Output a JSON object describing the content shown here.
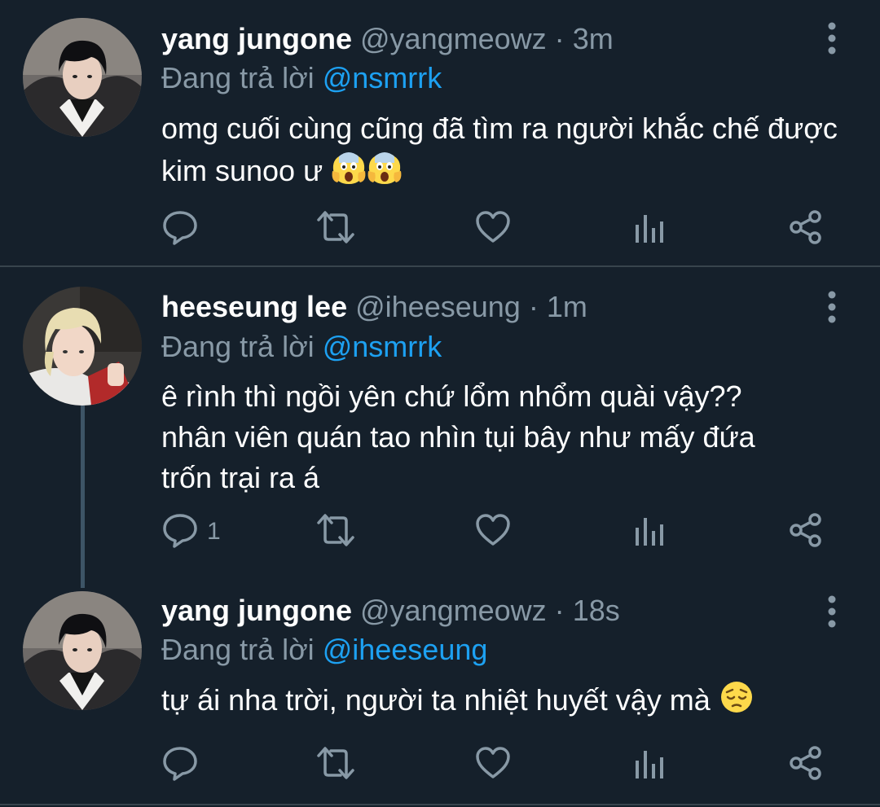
{
  "tweets": [
    {
      "display_name": "yang jungone",
      "handle": "@yangmeowz",
      "separator": "·",
      "time": "3m",
      "reply_prefix": "Đang trả lời",
      "reply_to": "@nsmrrk",
      "text": "omg cuối cùng cũng đã tìm ra người khắc chế được kim sunoo ư",
      "emojis": [
        "screaming-face",
        "screaming-face"
      ],
      "reply_count": "",
      "avatar": "avatar-dark-hair"
    },
    {
      "display_name": "heeseung lee",
      "handle": "@iheeseung",
      "separator": "·",
      "time": "1m",
      "reply_prefix": "Đang trả lời",
      "reply_to": "@nsmrrk",
      "text": "ê rình thì ngồi yên chứ lổm nhổm quài vậy?? nhân viên quán tao nhìn tụi bây như mấy đứa trốn trại ra á",
      "emojis": [],
      "reply_count": "1",
      "avatar": "avatar-blonde-hair"
    },
    {
      "display_name": "yang jungone",
      "handle": "@yangmeowz",
      "separator": "·",
      "time": "18s",
      "reply_prefix": "Đang trả lời",
      "reply_to": "@iheeseung",
      "text": "tự ái nha trời, người ta nhiệt huyết vậy mà",
      "emojis": [
        "pensive-face"
      ],
      "reply_count": "",
      "avatar": "avatar-dark-hair"
    }
  ],
  "icons": {
    "reply": "reply-icon",
    "retweet": "retweet-icon",
    "like": "heart-icon",
    "analytics": "analytics-icon",
    "share": "share-icon",
    "more": "more-vertical-icon"
  },
  "colors": {
    "background": "#15202b",
    "text": "#ffffff",
    "secondary": "#8899a6",
    "accent": "#1da1f2",
    "divider": "#38444d"
  }
}
